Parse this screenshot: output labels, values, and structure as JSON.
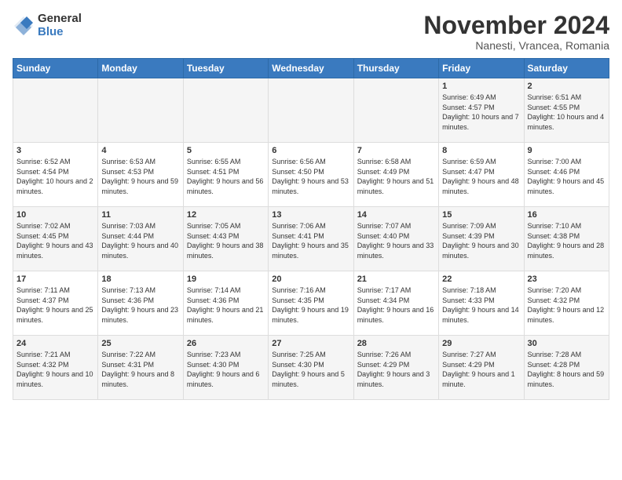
{
  "logo": {
    "general": "General",
    "blue": "Blue"
  },
  "title": "November 2024",
  "subtitle": "Nanesti, Vrancea, Romania",
  "days_header": [
    "Sunday",
    "Monday",
    "Tuesday",
    "Wednesday",
    "Thursday",
    "Friday",
    "Saturday"
  ],
  "weeks": [
    [
      {
        "day": "",
        "info": ""
      },
      {
        "day": "",
        "info": ""
      },
      {
        "day": "",
        "info": ""
      },
      {
        "day": "",
        "info": ""
      },
      {
        "day": "",
        "info": ""
      },
      {
        "day": "1",
        "info": "Sunrise: 6:49 AM\nSunset: 4:57 PM\nDaylight: 10 hours and 7 minutes."
      },
      {
        "day": "2",
        "info": "Sunrise: 6:51 AM\nSunset: 4:55 PM\nDaylight: 10 hours and 4 minutes."
      }
    ],
    [
      {
        "day": "3",
        "info": "Sunrise: 6:52 AM\nSunset: 4:54 PM\nDaylight: 10 hours and 2 minutes."
      },
      {
        "day": "4",
        "info": "Sunrise: 6:53 AM\nSunset: 4:53 PM\nDaylight: 9 hours and 59 minutes."
      },
      {
        "day": "5",
        "info": "Sunrise: 6:55 AM\nSunset: 4:51 PM\nDaylight: 9 hours and 56 minutes."
      },
      {
        "day": "6",
        "info": "Sunrise: 6:56 AM\nSunset: 4:50 PM\nDaylight: 9 hours and 53 minutes."
      },
      {
        "day": "7",
        "info": "Sunrise: 6:58 AM\nSunset: 4:49 PM\nDaylight: 9 hours and 51 minutes."
      },
      {
        "day": "8",
        "info": "Sunrise: 6:59 AM\nSunset: 4:47 PM\nDaylight: 9 hours and 48 minutes."
      },
      {
        "day": "9",
        "info": "Sunrise: 7:00 AM\nSunset: 4:46 PM\nDaylight: 9 hours and 45 minutes."
      }
    ],
    [
      {
        "day": "10",
        "info": "Sunrise: 7:02 AM\nSunset: 4:45 PM\nDaylight: 9 hours and 43 minutes."
      },
      {
        "day": "11",
        "info": "Sunrise: 7:03 AM\nSunset: 4:44 PM\nDaylight: 9 hours and 40 minutes."
      },
      {
        "day": "12",
        "info": "Sunrise: 7:05 AM\nSunset: 4:43 PM\nDaylight: 9 hours and 38 minutes."
      },
      {
        "day": "13",
        "info": "Sunrise: 7:06 AM\nSunset: 4:41 PM\nDaylight: 9 hours and 35 minutes."
      },
      {
        "day": "14",
        "info": "Sunrise: 7:07 AM\nSunset: 4:40 PM\nDaylight: 9 hours and 33 minutes."
      },
      {
        "day": "15",
        "info": "Sunrise: 7:09 AM\nSunset: 4:39 PM\nDaylight: 9 hours and 30 minutes."
      },
      {
        "day": "16",
        "info": "Sunrise: 7:10 AM\nSunset: 4:38 PM\nDaylight: 9 hours and 28 minutes."
      }
    ],
    [
      {
        "day": "17",
        "info": "Sunrise: 7:11 AM\nSunset: 4:37 PM\nDaylight: 9 hours and 25 minutes."
      },
      {
        "day": "18",
        "info": "Sunrise: 7:13 AM\nSunset: 4:36 PM\nDaylight: 9 hours and 23 minutes."
      },
      {
        "day": "19",
        "info": "Sunrise: 7:14 AM\nSunset: 4:36 PM\nDaylight: 9 hours and 21 minutes."
      },
      {
        "day": "20",
        "info": "Sunrise: 7:16 AM\nSunset: 4:35 PM\nDaylight: 9 hours and 19 minutes."
      },
      {
        "day": "21",
        "info": "Sunrise: 7:17 AM\nSunset: 4:34 PM\nDaylight: 9 hours and 16 minutes."
      },
      {
        "day": "22",
        "info": "Sunrise: 7:18 AM\nSunset: 4:33 PM\nDaylight: 9 hours and 14 minutes."
      },
      {
        "day": "23",
        "info": "Sunrise: 7:20 AM\nSunset: 4:32 PM\nDaylight: 9 hours and 12 minutes."
      }
    ],
    [
      {
        "day": "24",
        "info": "Sunrise: 7:21 AM\nSunset: 4:32 PM\nDaylight: 9 hours and 10 minutes."
      },
      {
        "day": "25",
        "info": "Sunrise: 7:22 AM\nSunset: 4:31 PM\nDaylight: 9 hours and 8 minutes."
      },
      {
        "day": "26",
        "info": "Sunrise: 7:23 AM\nSunset: 4:30 PM\nDaylight: 9 hours and 6 minutes."
      },
      {
        "day": "27",
        "info": "Sunrise: 7:25 AM\nSunset: 4:30 PM\nDaylight: 9 hours and 5 minutes."
      },
      {
        "day": "28",
        "info": "Sunrise: 7:26 AM\nSunset: 4:29 PM\nDaylight: 9 hours and 3 minutes."
      },
      {
        "day": "29",
        "info": "Sunrise: 7:27 AM\nSunset: 4:29 PM\nDaylight: 9 hours and 1 minute."
      },
      {
        "day": "30",
        "info": "Sunrise: 7:28 AM\nSunset: 4:28 PM\nDaylight: 8 hours and 59 minutes."
      }
    ]
  ]
}
